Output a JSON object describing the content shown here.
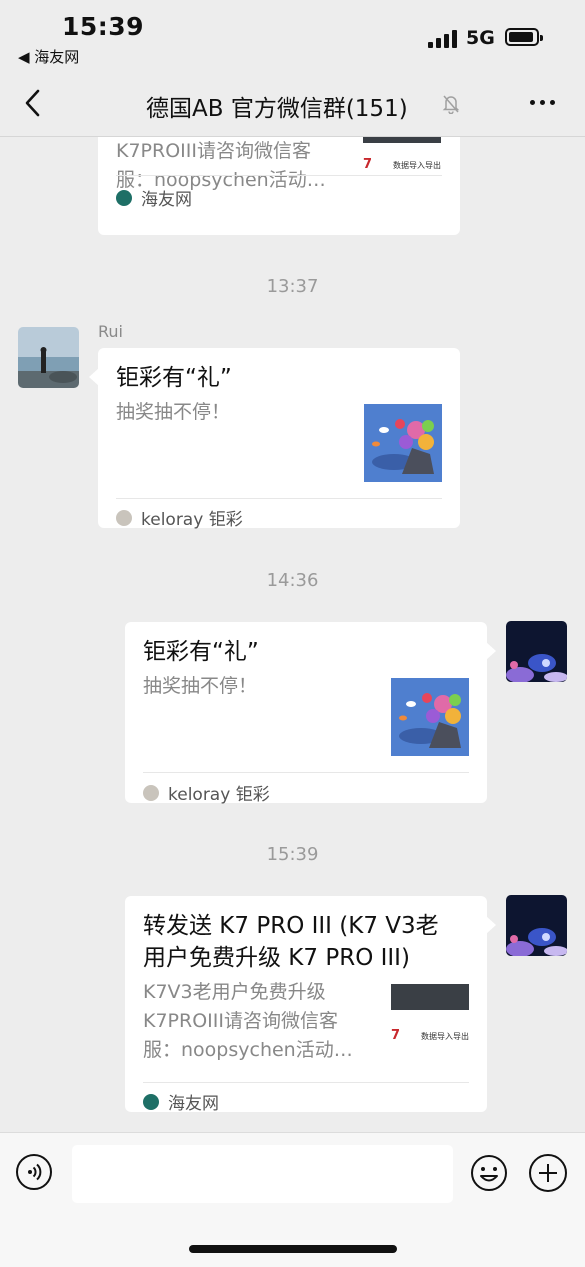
{
  "status_bar": {
    "time": "15:39",
    "back_app": "◀ 海友网",
    "network": "5G"
  },
  "nav": {
    "title": "德国AB 官方微信群(151)",
    "back_icon": "chevron-left-icon",
    "mute_icon": "bell-slash-icon",
    "more_icon": "more-dots-icon"
  },
  "messages": [
    {
      "type": "link_card_partial",
      "side": "left",
      "desc": "K7PROIII请咨询微信客\n服：noopsychen活动…",
      "source": "海友网",
      "thumb_text": "数据导入导出"
    },
    {
      "type": "timestamp",
      "text": "13:37"
    },
    {
      "type": "link_card",
      "side": "left",
      "sender": "Rui",
      "title": "钜彩有“礼”",
      "desc": "抽奖抽不停！",
      "source": "keloray 钜彩"
    },
    {
      "type": "timestamp",
      "text": "14:36"
    },
    {
      "type": "link_card",
      "side": "right",
      "title": "钜彩有“礼”",
      "desc": "抽奖抽不停！",
      "source": "keloray 钜彩"
    },
    {
      "type": "timestamp",
      "text": "15:39"
    },
    {
      "type": "link_card",
      "side": "right",
      "title": "转发送 K7 PRO III (K7 V3老\n用户免费升级 K7 PRO III)",
      "desc": "K7V3老用户免费升级\nK7PROIII请咨询微信客\n服：noopsychen活动…",
      "source": "海友网",
      "thumb_text": "数据导入导出"
    }
  ],
  "input_bar": {
    "voice_icon": "voice-icon",
    "emoji_icon": "emoji-icon",
    "plus_icon": "plus-icon"
  },
  "colors": {
    "background": "#ededed",
    "card": "#ffffff",
    "timestamp": "#9a9a9a",
    "desc": "#888888"
  }
}
